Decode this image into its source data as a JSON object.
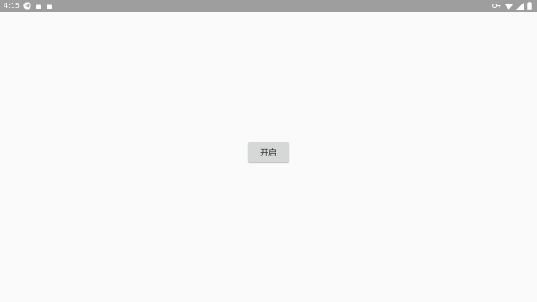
{
  "status_bar": {
    "time": "4:15",
    "left_icons": [
      "telegram-icon",
      "android-icon",
      "android-icon"
    ],
    "right_icons": [
      "key-icon",
      "wifi-icon",
      "signal-icon",
      "battery-icon"
    ],
    "background": "#9e9e9e"
  },
  "main": {
    "button_label": "开启",
    "background": "#fafafa"
  }
}
